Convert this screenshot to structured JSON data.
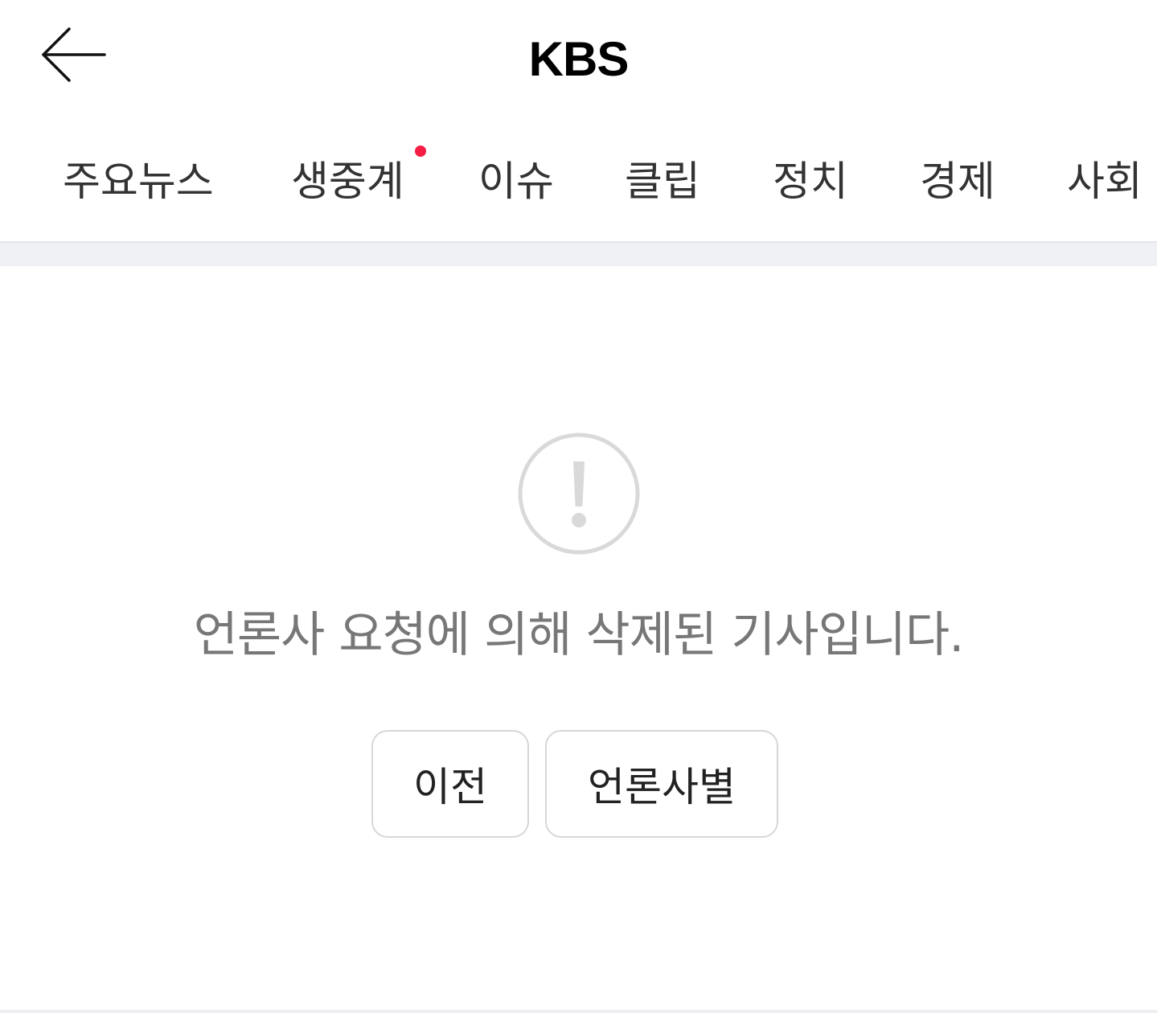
{
  "header": {
    "back_icon": "arrow-left-icon",
    "title": "KBS"
  },
  "tabs": [
    {
      "label": "주요뉴스",
      "has_dot": false
    },
    {
      "label": "생중계",
      "has_dot": true
    },
    {
      "label": "이슈",
      "has_dot": false
    },
    {
      "label": "클립",
      "has_dot": false
    },
    {
      "label": "정치",
      "has_dot": false
    },
    {
      "label": "경제",
      "has_dot": false
    },
    {
      "label": "사회",
      "has_dot": false
    }
  ],
  "notice": {
    "icon": "exclamation-circle-icon",
    "message": "언론사 요청에 의해 삭제된 기사입니다.",
    "buttons": {
      "previous": "이전",
      "by_press": "언론사별"
    }
  },
  "colors": {
    "dot": "#f51d45",
    "message_text": "#777777",
    "icon": "#d9d9d9",
    "band": "#eef0f4"
  }
}
